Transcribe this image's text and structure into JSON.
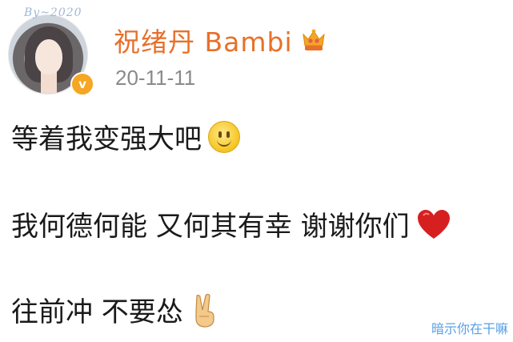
{
  "avatar": {
    "decoration_text": "By~2020"
  },
  "user": {
    "name": "祝绪丹 Bambi"
  },
  "post": {
    "date": "20-11-11",
    "lines": [
      {
        "text": "等着我变强大吧",
        "emoji": "smile-emoji"
      },
      {
        "text": "我何德何能  又何其有幸  谢谢你们",
        "emoji": "red-heart-emoji"
      },
      {
        "text": "往前冲  不要怂",
        "emoji": "victory-hand-emoji"
      }
    ]
  },
  "watermark": {
    "text": "暗示你在干嘛"
  },
  "colors": {
    "username": "#e8702a",
    "date": "#8a8a8a",
    "verified": "#f5a623",
    "heart": "#d62020"
  }
}
